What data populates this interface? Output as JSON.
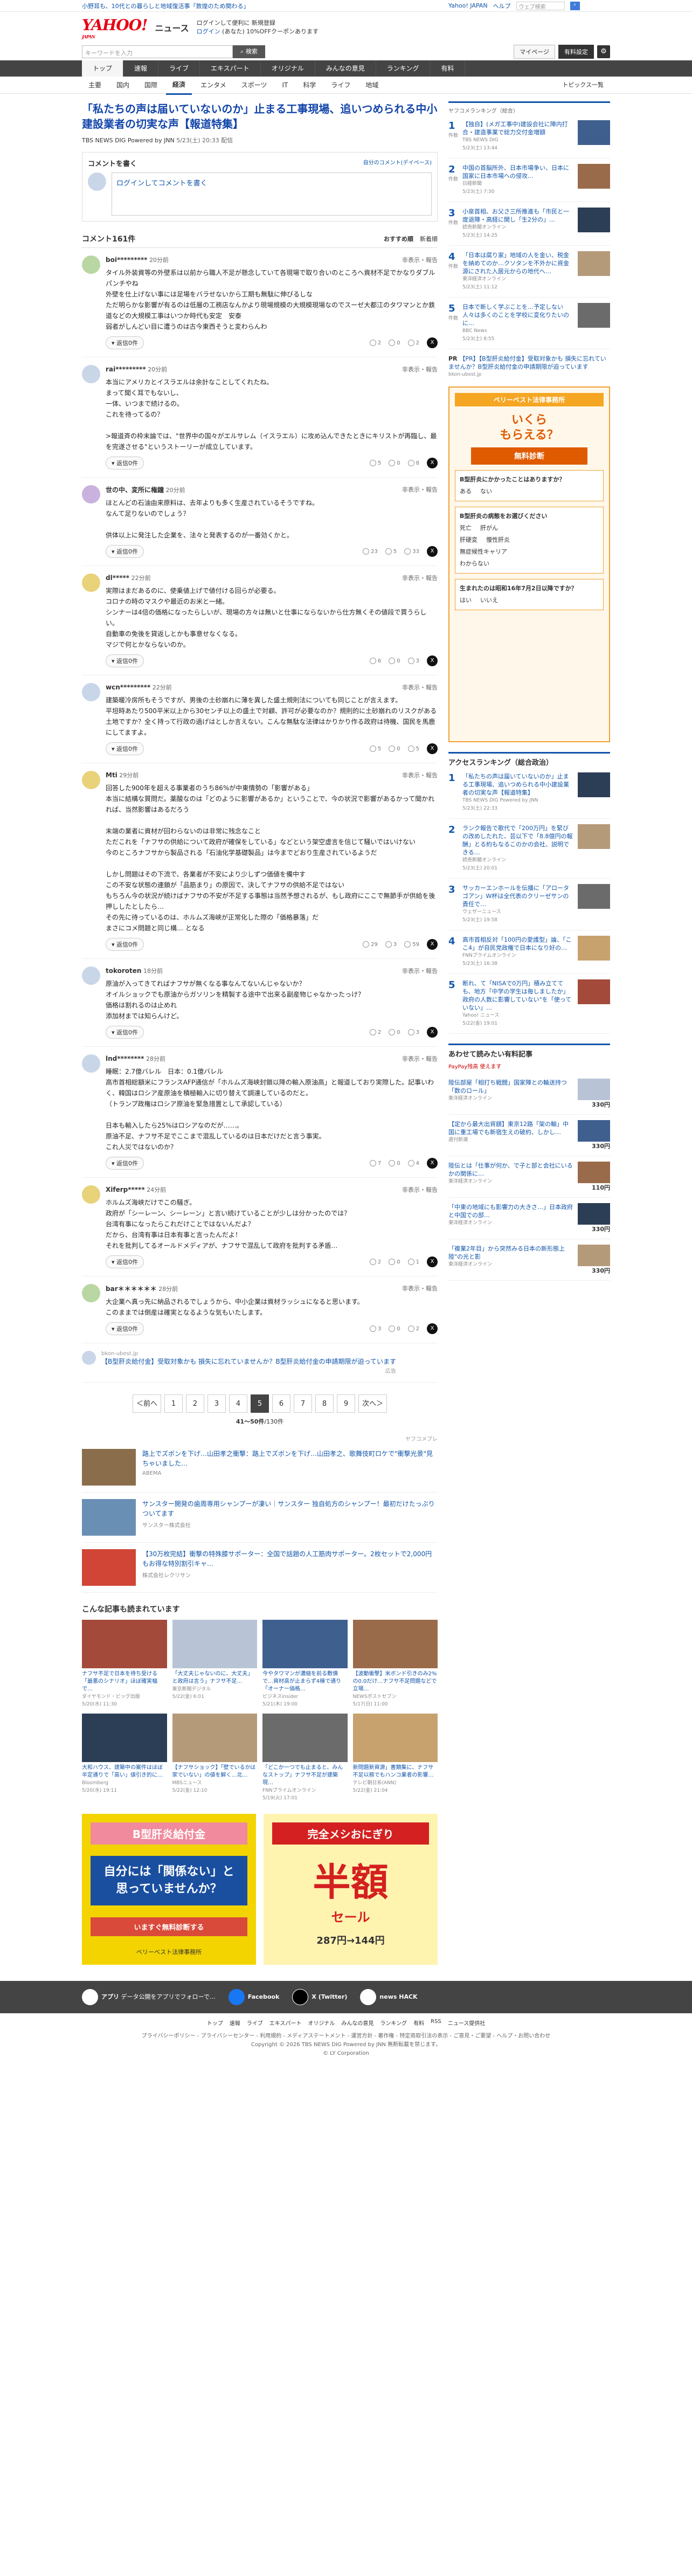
{
  "topstrip": {
    "left_text": "小野耳も、10代との暮らしと地域復活事「敦煌のため関わる」",
    "links": [
      "Yahoo! JAPAN",
      "ヘルプ"
    ],
    "search_placeholder": "ウェブ検索"
  },
  "header": {
    "logo": "YAHOO!",
    "logo_sub": "JAPAN",
    "section": "ニュース",
    "info_line1": "ログインして便利に 新規登録",
    "info_line2": "ログイン",
    "info_line2_extra": "(あなた) 10%OFFクーポンあります",
    "search_placeholder": "キーワードを入力",
    "search_button": "検索",
    "mypage": "マイページ",
    "subscribe": "有料設定"
  },
  "nav": {
    "items": [
      "トップ",
      "速報",
      "ライブ",
      "エキスパート",
      "オリジナル",
      "みんなの意見",
      "ランキング",
      "有料"
    ]
  },
  "subnav": {
    "items": [
      "主要",
      "国内",
      "国際",
      "経済",
      "エンタメ",
      "スポーツ",
      "IT",
      "科学",
      "ライフ",
      "地域"
    ],
    "right": "トピックス一覧"
  },
  "article": {
    "title": "「私たちの声は届いていないのか」止まる工事現場、追いつめられる中小建設業者の切実な声【報道特集】",
    "source": "TBS NEWS DIG Powered by JNN",
    "date": "5/23(土) 20:33 配信"
  },
  "comment_box": {
    "title": "コメントを書く",
    "policy": "自分のコメント(デイペース)",
    "prompt": "ログインしてコメントを書く",
    "prompt_link": "ログイン"
  },
  "comment_list": {
    "count_label": "コメント161件",
    "sorts": [
      "おすすめ順",
      "新着順"
    ]
  },
  "comments": [
    {
      "user": "boi*********",
      "time": "20分前",
      "report": "非表示・報告",
      "text": "タイル外装資等の外壁系は以前から職人不足が懸念していて各現場で取り合いのところへ資材不足でかなりダブルパンチやね\n外壁を仕上げない事には足場をバラせないから工期も無駄に伸びるしな\nただ明らかな影響が有るのは低層の工務店なんかより現場規模の大規模現場なのでスーゼ大都江のタワマンとか鉄道などの大規模工事はいつか時代も安定　安泰\n弱者がしんどい目に遭うのは古今東西そうと変わらんわ",
      "likes": "2",
      "dislikes": "0",
      "neutral": "2"
    },
    {
      "user": "rai*********",
      "time": "20分前",
      "report": "非表示・報告",
      "text": "本当にアメリカとイスラエルは余計なことしてくれたね。\nまって聞く耳でもないし、\n一体、いつまで続けるの。\nこれを待ってるの？\n\n>報道斉の枠末論では、\"世界中の国々がエルサレム（イスラエル）に攻め込んできたときにキリストが再臨し、最を完遂させる\"というストーリーが成立しています。",
      "likes": "5",
      "dislikes": "0",
      "neutral": "8"
    },
    {
      "user": "世の中、変所に権鐘",
      "time": "20分前",
      "report": "非表示・報告",
      "text": "ほとんどの石油由来原料は、去年よりも多く生産されているそうですね。\nなんて足りないのでしょう？\n\n供体以上に発注した企業を、法々と発表するのが一番効くかと。",
      "likes": "23",
      "dislikes": "5",
      "neutral": "33"
    },
    {
      "user": "dl*****",
      "time": "22分前",
      "report": "非表示・報告",
      "text": "実際はまだあるのに、使乗値上げで値付ける回らが必要る。\nコロナの時のマスクや最近のお米と一緒。\nシンナーは4倍の価格になったらしいが、現場の方々は無いと仕事にならないから仕方無くその値段で買うらしい。\n自動車の免後を貸返しとかも事意せなくなる。\nマジで何とかならないのか。",
      "likes": "6",
      "dislikes": "0",
      "neutral": "3"
    },
    {
      "user": "wcn*********",
      "time": "22分前",
      "report": "非表示・報告",
      "text": "建築暖冷房所もそうですが、男後の土砂崩れに薄を異した盛土規則法についても同じことが言えます。\n平坦時あたり500平米以上から30センチ以上の盛土で対顧、許可が必要なのか？規則的に土砂崩れのリスクがある土地ですか？全く持って行政の過げはとしか言えない。こんな無駄な法律はかりかり作る政府は待機、国民を馬鹿にしてますよ。",
      "likes": "5",
      "dislikes": "0",
      "neutral": "5"
    },
    {
      "user": "Mti",
      "time": "29分前",
      "report": "非表示・報告",
      "text": "回答した900年を超える事業者のうち86%が中東情勢の「影響がある」\n本当に結構な質問だ。薬酸なのは「どのように影響があるか」ということで、今の状況で影響があるかって聞かれれば、当然影響はあるだろう\n\n末端の業者に資材が回わらないのは非常に残念なこと\nただこれを「ナフサの供給について政府が確保をしている」などという架空虚言を信じて騒いではいけない\n今のところナフサから製品される「石油化学基礎製品」は今までどおり生産されているようだ\n\nしかし問題はその下流で、各業者が不安により少しずつ価値を備中す\nこの不安な状態の連鎖が「品筋まり」の原因で、決してナフサの供給不足ではない\nもちろん今の状況が続けばナフサの不安が不足する事態は当然予想されるが、もし政府にここで無節手が供給を後押ししたとしたら…\nその先に待っているのは、ホルムズ海峡が正常化した際の「価格暴落」だ\nまさにコメ問題と同じ構… となる",
      "likes": "29",
      "dislikes": "3",
      "neutral": "59"
    },
    {
      "user": "tokoroten",
      "time": "18分前",
      "report": "非表示・報告",
      "text": "原油が入ってきてればナフサが無くなる事なんてないんじゃないか？\nオイルショックでも原油からガソリンを精製する途中で出来る副産物じゃなかったっけ？\n価格は割れるのは止めれ\n添加材までは知らんけど。",
      "likes": "2",
      "dislikes": "0",
      "neutral": "3"
    },
    {
      "user": "lnd********",
      "time": "28分前",
      "report": "非表示・報告",
      "text": "睡眠：2.7億バレル　日本：0.1億バレル\n高市首相総額米にフランスAFP通信が「ホルムズ海峡封鎖以降の輸入原油高」と報道しており実際した。記事いわく、韓国はロシア産原油を積極輸入に切り替えて調達しているのだと。\n（トランプ政権はロシア原油を緊急措置として承認している）\n\n日本も輸入したら25%はロシアなのだが……。\n原油不足、ナフサ不足でここまで混乱しているのは日本だけだと言う事実。\nこれ人災ではないのか？",
      "likes": "7",
      "dislikes": "0",
      "neutral": "4"
    },
    {
      "user": "Xiferp*****",
      "time": "24分前",
      "report": "非表示・報告",
      "text": "ホルムズ海峡だけでこの騒ぎ。\n政府が「シーレーン、シーレーン」と言い続けていることが少しは分かったのでは？\n台湾有事になったらこれだけことではないんだよ？\nだから、台湾有事は日本有事と言ったんだよ！\nそれを批判してるオールドメディアが、ナフサで混乱して政府を批判する矛盾…",
      "likes": "2",
      "dislikes": "0",
      "neutral": "1"
    },
    {
      "user": "bar＊＊＊＊＊＊",
      "time": "28分前",
      "report": "非表示・報告",
      "text": "大企業へ真っ先に納品されるでしょうから、中小企業は資材ラッシュになると思います。\nこのままでは倒産は確実となるような気もいたします。",
      "likes": "3",
      "dislikes": "0",
      "neutral": "2"
    }
  ],
  "inline_ad": {
    "tag": "bkon-ubest.jp",
    "text": "【B型肝炎給付金】受取対象かも 損失に忘れていませんか？B型肝炎給付金の申請期限が迫っています",
    "label": "広告"
  },
  "pager": {
    "prev": "＜前へ",
    "pages": [
      "1",
      "2",
      "3",
      "4",
      "5",
      "6",
      "7",
      "8",
      "9"
    ],
    "current": "5",
    "next": "次へ＞",
    "info": "41～50件",
    "total": "/130件"
  },
  "sponsor": {
    "label": "ヤフコメプレ",
    "items": [
      {
        "title": "路上でズボンを下げ…山田孝之衝撃：路上でズボンを下げ…山田孝之、歌舞伎町ロケで\"衝撃光景\"見ちゃいました…",
        "source": "ABEMA"
      },
      {
        "title": "サンスター開発の歯周専用シャンプーが凄い｜サンスター 独自処方のシャンプー！最初だけたっぷりついてます",
        "source": "サンスター株式会社"
      },
      {
        "title": "【30万枚完結】衝撃の特殊膝サポーター：全国で話題の人工筋肉サポーター。2枚セットで2,000円もお得な特別割引キャ…",
        "source": "株式会社レクリサン"
      }
    ]
  },
  "recs": {
    "title": "こんな記事も読まれています",
    "items": [
      {
        "title": "ナフサ不足で日本を待ち受ける「最悪のシナリオ」ほぼ確実幅で…",
        "source": "ダイヤモンド・ビッグ出版",
        "date": "5/20(水) 11:30"
      },
      {
        "title": "「大丈夫じゃないのに、大丈夫」と政府は言う」ナフサ不足…",
        "source": "東京新聞デジタル",
        "date": "5/22(金) 6:01"
      },
      {
        "title": "今やタワマンが濃縮を前る敷債で…資材高が止まらず4棟で通り「オーナー価格…",
        "source": "ビジネスinsider",
        "date": "5/21(木) 19:00"
      },
      {
        "title": "【波動衝撃】米ボンド引きのみ2%の0.0だけ…ナフサ不足問題などで立場…",
        "source": "NEWSポストセブン",
        "date": "5/17(日) 11:00"
      },
      {
        "title": "大和ハウス、建築中の案件はほぼ半定通りで「高い」値引き的に…",
        "source": "Bloomberg",
        "date": "5/20(水) 19:11"
      },
      {
        "title": "【ナフサショック】「壁でいるかは家でいない」の値を解く…北…",
        "source": "MBSニュース",
        "date": "5/22(金) 12:10"
      },
      {
        "title": "「どこか一つでも止まると、みんなストップ」ナフサ不足が建築現…",
        "source": "FNNプライムオンライン",
        "date": "5/19(火) 17:01"
      },
      {
        "title": "新問題新資源」書類集に、ナフサ不足以務でもハンコ業者の影響…",
        "source": "テレビ朝日系(ANN)",
        "date": "5/22(金) 21:04"
      }
    ]
  },
  "banners": {
    "left": {
      "title": "B型肝炎給付金",
      "body": "自分には「関係ない」と思っていませんか？",
      "cta": "いますぐ無料診断する",
      "brand": "ベリーベスト法律事務所"
    },
    "right": {
      "title": "完全メシおにぎり",
      "big": "半額",
      "sub": "セール",
      "price": "287円→144円"
    }
  },
  "side_ranking": {
    "title": "ヤフコメランキング（総合）",
    "subtitle": "",
    "items": [
      {
        "num": "1",
        "badge": "件数",
        "title": "【独自】(メガ工事中)建設会社に陣内打合・建造事業で総力交付金増額",
        "source": "TBS NEWS DIG",
        "date": "5/23(土) 13:44"
      },
      {
        "num": "2",
        "badge": "件数",
        "title": "中国の首脳所外、日本市場争い、日本に国家に日本市場への侵攻…",
        "source": "日経新聞",
        "date": "5/23(土) 7:30"
      },
      {
        "num": "3",
        "badge": "件数",
        "title": "小泉首相、お父さ三所推進も「市民と一度退陣・高経に関し「生2分の」…",
        "source": "読売新聞オンライン",
        "date": "5/23(土) 14:25"
      },
      {
        "num": "4",
        "badge": "件数",
        "title": "「日本は腐り家」地域の人を金い、税金を納めてのか…クソタンを不外かに資金源にされた入居元からの地代へ…",
        "source": "東洋経済オンライン",
        "date": "5/23(土) 11:12"
      },
      {
        "num": "5",
        "badge": "件数",
        "title": "日本で新しく学ぶことを…予定しない人々は多くのことを学校に変化りたいのに…",
        "source": "BBC News",
        "date": "5/23(土) 8:55"
      }
    ],
    "pr": "【PR】【B型肝炎給付金】受取対象かも 損失に忘れていませんか？B型肝炎給付金の申請期限が迫っています",
    "pr_source": "bkon-ubest.jp"
  },
  "side_ad": {
    "brand": "ベリーベスト法律事務所",
    "big1": "いくら",
    "big2": "もらえる？",
    "badge": "無料診断",
    "q1_title": "B型肝炎にかかったことはありますか？",
    "q1_opts": [
      "ある",
      "ない"
    ],
    "q2_title": "B型肝炎の病態をお選びください",
    "q2_opts": [
      "死亡",
      "肝がん",
      "肝硬変",
      "慢性肝炎",
      "無症候性キャリア",
      "わからない"
    ],
    "q3_title": "生まれたのは昭和16年7月2日以降ですか？",
    "q3_opts": [
      "はい",
      "いいえ"
    ]
  },
  "side_access": {
    "title": "アクセスランキング（総合政治）",
    "items": [
      {
        "num": "1",
        "title": "「私たちの声は届いていないのか」止まる工事現場、追いつめられる中小建設業者の切実な声【報道特集】",
        "source": "TBS NEWS DIG Powered by JNN",
        "date": "5/23(土) 22:33"
      },
      {
        "num": "2",
        "title": "ランク報告で歌代で「200万円」を緊びの改めしたれた、芸以下で「8.8億円の報酬」とる約もなるこのかの会社、説明できる…",
        "source": "読売新聞オンライン",
        "date": "5/23(土) 20:01"
      },
      {
        "num": "3",
        "title": "サッカーエンホールを伝播に「アロータゴアン」W杯は全代表のクリーゼサンの責任で…",
        "source": "ウェザーニュース",
        "date": "5/23(土) 19:58"
      },
      {
        "num": "4",
        "title": "高市首相反対「100円の愛護型」論、「ここ4」が自民党政権で日本になり好の…",
        "source": "FNNプライムオンライン",
        "date": "5/23(土) 16:38"
      },
      {
        "num": "5",
        "title": "断れ、て「NISAで0万円」積み立てても、地方「中学の学生は毎しましたか」政府の人数に影響していない\"を「使っていない」…",
        "source": "Yahoo! ニュース",
        "date": "5/22(金) 19:01"
      }
    ]
  },
  "side_pickup": {
    "title": "あわせて読みたい有料記事",
    "paypay": "PayPay残高 使えます",
    "items": [
      {
        "title": "陸伝部屋「相打ち戦闘」国家陣との輪送持つ「数のロール」",
        "source": "東洋経済オンライン",
        "price": "330円"
      },
      {
        "title": "【定から最大出資額】東京12路「架の輸」中国に重工場でも新宿生えの破約、しかし…",
        "source": "週刊新潮",
        "price": "330円"
      },
      {
        "title": "陸伝とは「仕事が何か、で子と部と会社にいるかの関係に…",
        "source": "東洋経済オンライン",
        "price": "110円"
      },
      {
        "title": "「中東の地域にも影響力の大きさ…」日本政府と中国での部…",
        "source": "東洋経済オンライン",
        "price": "330円"
      },
      {
        "title": "「複業2年目」から突然みる日本の新形態上陸\"の光と影",
        "source": "東洋経済オンライン",
        "price": "330円"
      }
    ]
  },
  "footer": {
    "apps": [
      {
        "name": "アプリ",
        "desc": "データ公開をアプリでフォローで…"
      },
      {
        "name": "Facebook",
        "desc": "公式記事、独自番組等もFacebookで毎日…"
      },
      {
        "name": "X (Twitter)",
        "desc": "リアルタイムニュースを毎日の…"
      },
      {
        "name": "news HACK",
        "desc": "Yahoo!ニュースのテクノロジーとデザイン"
      }
    ],
    "nav": [
      "トップ",
      "速報",
      "ライブ",
      "エキスパート",
      "オリジナル",
      "みんなの意見",
      "ランキング",
      "有料",
      "RSS",
      "ニュース提供社"
    ],
    "legal1": "プライバシーポリシー - プライバシーセンター - 利用規約 - メディアステートメント - 運営方針 - 著作権 - 特定商取引法の表示 - ご意見・ご要望 - ヘルプ・お問い合わせ",
    "legal2": "Copyright © 2026 TBS NEWS DIG Powered by JNN 無断転載を禁じます。",
    "legal3": "© LY Corporation"
  },
  "colors": {
    "accent": "#1155aa",
    "brand_red": "#e60012",
    "nav_bg": "#444444"
  }
}
